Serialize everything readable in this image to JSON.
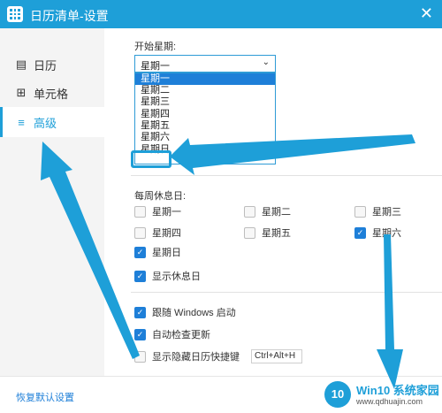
{
  "window": {
    "title": "日历清单-设置",
    "close_symbol": "✕"
  },
  "sidebar": {
    "items": [
      {
        "label": "日历",
        "icon": "calendar-icon",
        "glyph": "▤"
      },
      {
        "label": "单元格",
        "icon": "grid-icon",
        "glyph": "⊞"
      },
      {
        "label": "高级",
        "icon": "sliders-icon",
        "glyph": "≡",
        "active": true
      }
    ]
  },
  "week_start": {
    "label": "开始星期:",
    "selected": "星期一",
    "options": [
      "星期一",
      "星期二",
      "星期三",
      "星期四",
      "星期五",
      "星期六",
      "星期日"
    ],
    "highlighted": "星期一",
    "emphasized": "星期日"
  },
  "rest_days": {
    "label": "每周休息日:",
    "days": [
      {
        "label": "星期一",
        "checked": false
      },
      {
        "label": "星期二",
        "checked": false
      },
      {
        "label": "星期三",
        "checked": false
      },
      {
        "label": "星期四",
        "checked": false
      },
      {
        "label": "星期五",
        "checked": false
      },
      {
        "label": "星期六",
        "checked": true
      },
      {
        "label": "星期日",
        "checked": true
      }
    ],
    "show_rest_days": {
      "label": "显示休息日",
      "checked": true
    }
  },
  "options": {
    "startup": {
      "label": "跟随 Windows 启动",
      "checked": true
    },
    "auto_update": {
      "label": "自动检查更新",
      "checked": true
    },
    "hotkey": {
      "label": "显示隐藏日历快捷键",
      "checked": false,
      "value": "Ctrl+Alt+H"
    }
  },
  "footer": {
    "restore_label": "恢复默认设置"
  },
  "watermark": {
    "badge": "10",
    "title": "Win10 系统家园",
    "url": "www.qdhuajin.com"
  },
  "colors": {
    "accent": "#1e9fd8",
    "check": "#1e7fd8",
    "arrow": "#1e9fd8"
  }
}
